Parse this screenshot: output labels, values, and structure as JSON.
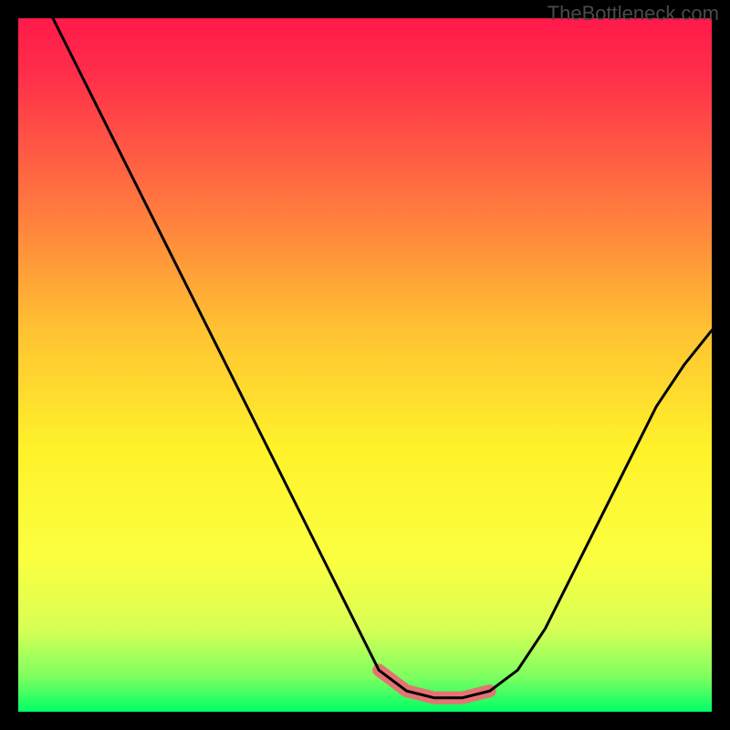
{
  "watermark": "TheBottleneck.com",
  "chart_data": {
    "type": "line",
    "title": "",
    "xlabel": "",
    "ylabel": "",
    "xlim": [
      0,
      100
    ],
    "ylim": [
      0,
      100
    ],
    "gradient_stops": [
      {
        "offset": 0.0,
        "color": "#ff1a4a"
      },
      {
        "offset": 0.08,
        "color": "#ff2e4a"
      },
      {
        "offset": 0.25,
        "color": "#ff7040"
      },
      {
        "offset": 0.45,
        "color": "#ffc232"
      },
      {
        "offset": 0.62,
        "color": "#fff22a"
      },
      {
        "offset": 0.78,
        "color": "#fbff40"
      },
      {
        "offset": 0.88,
        "color": "#d8ff55"
      },
      {
        "offset": 0.95,
        "color": "#7dff60"
      },
      {
        "offset": 1.0,
        "color": "#00ff66"
      }
    ],
    "series": [
      {
        "name": "curve",
        "color": "#000000",
        "x": [
          5,
          10,
          15,
          20,
          25,
          30,
          35,
          40,
          45,
          50,
          52,
          56,
          60,
          64,
          68,
          72,
          76,
          80,
          84,
          88,
          92,
          96,
          100
        ],
        "y": [
          100,
          90,
          80,
          70,
          60,
          50,
          40,
          30,
          20,
          10,
          6,
          3,
          2,
          2,
          3,
          6,
          12,
          20,
          28,
          36,
          44,
          50,
          55
        ]
      },
      {
        "name": "highlight-band",
        "color": "#e57373",
        "x": [
          52,
          56,
          60,
          64,
          68
        ],
        "y": [
          6,
          3,
          2,
          2,
          3
        ]
      }
    ]
  }
}
